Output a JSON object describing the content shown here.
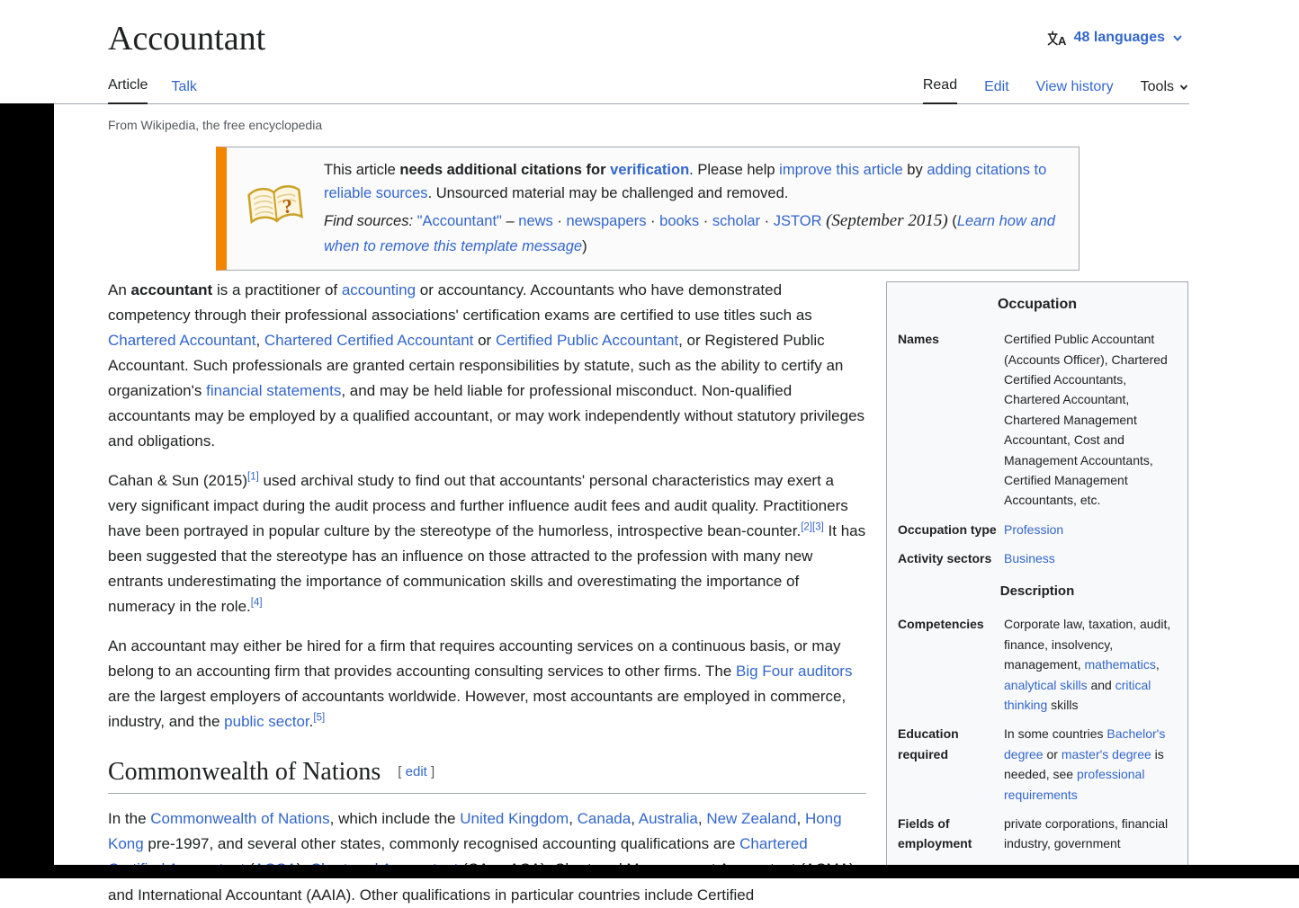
{
  "header": {
    "title": "Accountant",
    "languages_label": "48 languages",
    "tabs_left": [
      {
        "label": "Article",
        "active": true
      },
      {
        "label": "Talk",
        "active": false
      }
    ],
    "tabs_right": [
      {
        "label": "Read",
        "active": true
      },
      {
        "label": "Edit",
        "active": false
      },
      {
        "label": "View history",
        "active": false
      },
      {
        "label": "Tools",
        "active": false,
        "dropdown": true
      }
    ],
    "tagline": "From Wikipedia, the free encyclopedia"
  },
  "icons": {
    "language": "language-icon",
    "dropdown_chevron": "chevron-down-icon",
    "citation_book": "open-book-question-icon"
  },
  "colors": {
    "link": "#3366cc",
    "text": "#202122",
    "muted": "#54595d",
    "border": "#a2a9b1",
    "ambox_bar": "#f28500",
    "infobox_bg": "#f8f9fa"
  },
  "notice": {
    "body": [
      {
        "t": "This article "
      },
      {
        "t": "needs additional citations for ",
        "s": "b"
      },
      {
        "t": "verification",
        "s": "link b"
      },
      {
        "t": ". Please help "
      },
      {
        "t": "improve this article",
        "s": "link"
      },
      {
        "t": " by "
      },
      {
        "t": "adding citations to reliable sources",
        "s": "link"
      },
      {
        "t": ". Unsourced material may be challenged and removed."
      }
    ],
    "find_sources": [
      {
        "t": "Find sources:",
        "s": "i"
      },
      {
        "t": " "
      },
      {
        "t": "\"Accountant\"",
        "s": "link"
      },
      {
        "t": " – "
      },
      {
        "t": "news",
        "s": "link"
      },
      {
        "t": " · "
      },
      {
        "t": "newspapers",
        "s": "link"
      },
      {
        "t": " · "
      },
      {
        "t": "books",
        "s": "link"
      },
      {
        "t": " · "
      },
      {
        "t": "scholar",
        "s": "link"
      },
      {
        "t": " · "
      },
      {
        "t": "JSTOR",
        "s": "link"
      },
      {
        "t": " "
      },
      {
        "t": "(September 2015)",
        "s": "i date"
      },
      {
        "t": " ("
      },
      {
        "t": "Learn how and when to remove this template message",
        "s": "link i"
      },
      {
        "t": ")"
      }
    ]
  },
  "article": {
    "paragraphs": [
      [
        {
          "t": "An "
        },
        {
          "t": "accountant",
          "s": "b"
        },
        {
          "t": " is a practitioner of "
        },
        {
          "t": "accounting",
          "s": "link"
        },
        {
          "t": " or accountancy. Accountants who have demonstrated competency through their professional associations' certification exams are certified to use titles such as "
        },
        {
          "t": "Chartered Accountant",
          "s": "link"
        },
        {
          "t": ", "
        },
        {
          "t": "Chartered Certified Accountant",
          "s": "link"
        },
        {
          "t": " or "
        },
        {
          "t": "Certified Public Accountant",
          "s": "link"
        },
        {
          "t": ", or Registered Public Accountant. Such professionals are granted certain responsibilities by statute, such as the ability to certify an organization's "
        },
        {
          "t": "financial statements",
          "s": "link"
        },
        {
          "t": ", and may be held liable for professional misconduct. Non-qualified accountants may be employed by a qualified accountant, or may work independently without statutory privileges and obligations."
        }
      ],
      [
        {
          "t": "Cahan & Sun (2015)"
        },
        {
          "t": "[1]",
          "s": "link sup"
        },
        {
          "t": " used archival study to find out that accountants' personal characteristics may exert a very significant impact during the audit process and further influence audit fees and audit quality. Practitioners have been portrayed in popular culture by the stereotype of the humorless, introspective bean-counter."
        },
        {
          "t": "[2]",
          "s": "link sup"
        },
        {
          "t": "[3]",
          "s": "link sup"
        },
        {
          "t": " It has been suggested that the stereotype has an influence on those attracted to the profession with many new entrants underestimating the importance of communication skills and overestimating the importance of numeracy in the role."
        },
        {
          "t": "[4]",
          "s": "link sup"
        }
      ],
      [
        {
          "t": "An accountant may either be hired for a firm that requires accounting services on a continuous basis, or may belong to an accounting firm that provides accounting consulting services to other firms. The "
        },
        {
          "t": "Big Four auditors",
          "s": "link"
        },
        {
          "t": " are the largest employers of accountants worldwide. However, most accountants are employed in commerce, industry, and the "
        },
        {
          "t": "public sector",
          "s": "link"
        },
        {
          "t": "."
        },
        {
          "t": "[5]",
          "s": "link sup"
        }
      ]
    ],
    "section": {
      "title": "Commonwealth of Nations",
      "edit_open": "[ ",
      "edit_label": "edit",
      "edit_close": " ]",
      "paragraph": [
        {
          "t": "In the "
        },
        {
          "t": "Commonwealth of Nations",
          "s": "link"
        },
        {
          "t": ", which include the "
        },
        {
          "t": "United Kingdom",
          "s": "link"
        },
        {
          "t": ", "
        },
        {
          "t": "Canada",
          "s": "link"
        },
        {
          "t": ", "
        },
        {
          "t": "Australia",
          "s": "link"
        },
        {
          "t": ", "
        },
        {
          "t": "New Zealand",
          "s": "link"
        },
        {
          "t": ", "
        },
        {
          "t": "Hong Kong",
          "s": "link"
        },
        {
          "t": " pre-1997, and several other states, commonly recognised accounting qualifications are "
        },
        {
          "t": "Chartered Certified Accountant",
          "s": "link"
        },
        {
          "t": " ("
        },
        {
          "t": "ACCA",
          "s": "link"
        },
        {
          "t": "), "
        },
        {
          "t": "Chartered Accountant",
          "s": "link"
        },
        {
          "t": " (CA or ACA), Chartered Management Accountant (ACMA) and International Accountant (AAIA). Other qualifications in particular countries include Certified"
        }
      ]
    }
  },
  "infobox": {
    "title": "Occupation",
    "subheader": "Description",
    "rows": [
      {
        "label": "Names",
        "value": [
          {
            "t": "Certified Public Accountant (Accounts Officer), Chartered Certified Accountants, Chartered Accountant, Chartered Management Accountant, Cost and Management Accountants, Certified Management Accountants, etc."
          }
        ]
      },
      {
        "label": "Occupation type",
        "value": [
          {
            "t": "Profession",
            "s": "link"
          }
        ]
      },
      {
        "label": "Activity sectors",
        "value": [
          {
            "t": "Business",
            "s": "link"
          }
        ]
      },
      {
        "label": "Competencies",
        "value": [
          {
            "t": "Corporate law, taxation, audit, finance, insolvency, management, "
          },
          {
            "t": "mathematics",
            "s": "link"
          },
          {
            "t": ", "
          },
          {
            "t": "analytical skills",
            "s": "link"
          },
          {
            "t": " and "
          },
          {
            "t": "critical thinking",
            "s": "link"
          },
          {
            "t": " skills"
          }
        ]
      },
      {
        "label": "Education required",
        "value": [
          {
            "t": "In some countries "
          },
          {
            "t": "Bachelor's degree",
            "s": "link"
          },
          {
            "t": " or "
          },
          {
            "t": "master's degree",
            "s": "link"
          },
          {
            "t": " is needed, see "
          },
          {
            "t": "professional requirements",
            "s": "link"
          }
        ]
      },
      {
        "label": "Fields of employment",
        "value": [
          {
            "t": "private corporations, financial industry, government"
          }
        ]
      }
    ]
  }
}
